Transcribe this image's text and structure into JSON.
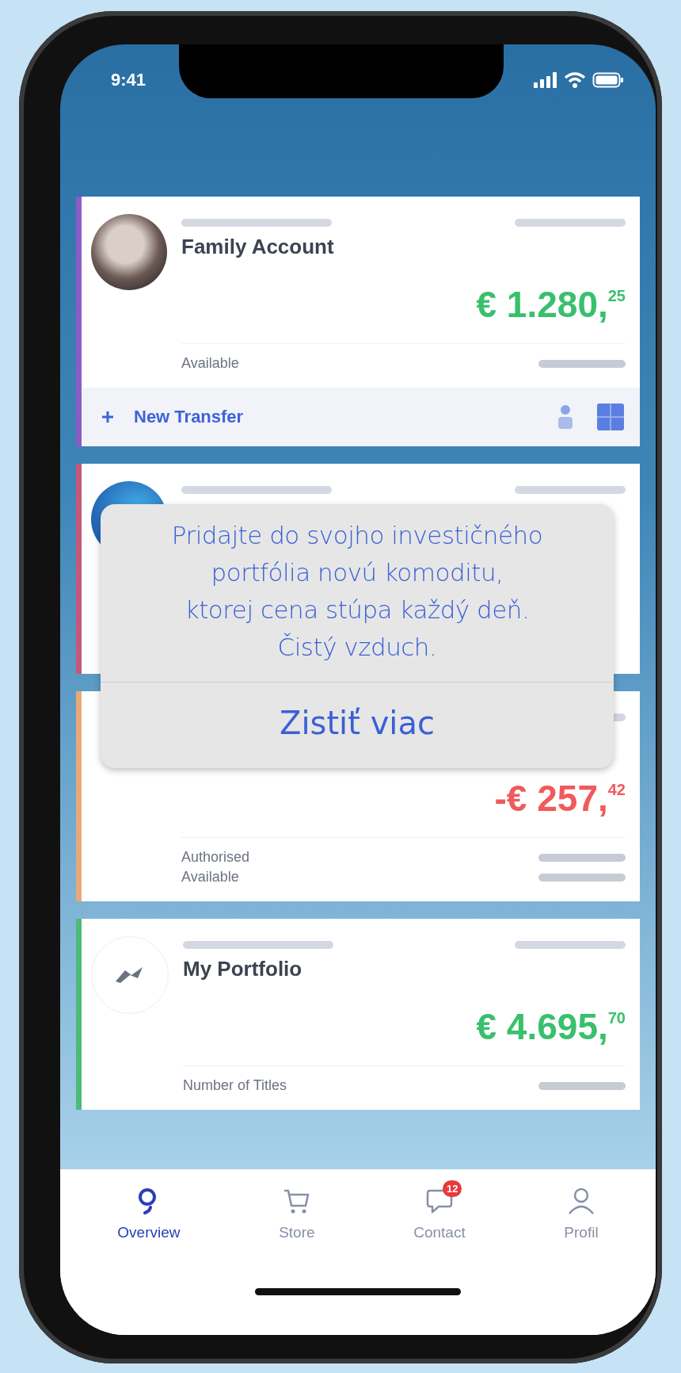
{
  "status_bar": {
    "time": "9:41"
  },
  "accounts": [
    {
      "color": "#8a5cc8",
      "name": "Family Account",
      "amount": "€ 1.280,$^{25}$",
      "negative": false,
      "rows": [
        {
          "label": "Available"
        }
      ],
      "action": "New Transfer"
    },
    {
      "color": "#c4577a"
    },
    {
      "color": "#e8a878",
      "amount": "-€ 257,$^{42}$",
      "negative": true,
      "rows": [
        {
          "label": "Authorised"
        },
        {
          "label": "Available"
        }
      ]
    },
    {
      "color": "#4cbb78",
      "name": "My Portfolio",
      "amount": "€ 4.695,$^{70}$",
      "negative": false,
      "rows": [
        {
          "label": "Number of Titles"
        }
      ]
    }
  ],
  "dialog": {
    "message": "Pridajte do svojho investičného\nportfólia novú komoditu,\nktorej cena stúpa každý deň.\nČistý vzduch.",
    "button": "Zistiť viac"
  },
  "tab_bar": [
    {
      "label": "Overview",
      "selected": true
    },
    {
      "label": "Store",
      "selected": false
    },
    {
      "label": "Contact",
      "selected": false,
      "badge": "12"
    },
    {
      "label": "Profil",
      "selected": false
    }
  ]
}
